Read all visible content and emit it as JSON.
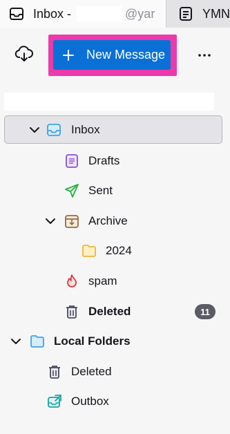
{
  "tabs": [
    {
      "title": "Inbox -",
      "account_suffix": "@yar",
      "icon": "inbox-tab-icon",
      "active": true
    },
    {
      "title": "YMN",
      "icon": "document-tab-icon",
      "active": false
    }
  ],
  "toolbar": {
    "get_mail_icon": "cloud-download-icon",
    "new_message_label": "New Message",
    "more_icon": "ellipsis-icon"
  },
  "folders": {
    "inbox": {
      "label": "Inbox",
      "expanded": true,
      "selected": true
    },
    "drafts": {
      "label": "Drafts"
    },
    "sent": {
      "label": "Sent"
    },
    "archive": {
      "label": "Archive",
      "expanded": true
    },
    "archive_2024": {
      "label": "2024"
    },
    "spam": {
      "label": "spam"
    },
    "deleted": {
      "label": "Deleted",
      "unread_count": "11"
    },
    "local_folders": {
      "label": "Local Folders",
      "expanded": true
    },
    "local_deleted": {
      "label": "Deleted"
    },
    "outbox": {
      "label": "Outbox"
    }
  },
  "colors": {
    "accent": "#0a70d6",
    "highlight_frame": "#ec3aab",
    "drafts": "#8b52d6",
    "sent": "#2bb043",
    "archive": "#9a6a3c",
    "folder": "#e8b83a",
    "spam": "#e2343b",
    "trash": "#4a4a60",
    "inbox": "#3da2e6",
    "outbox": "#17a3a0",
    "badge": "#5b5b66"
  }
}
